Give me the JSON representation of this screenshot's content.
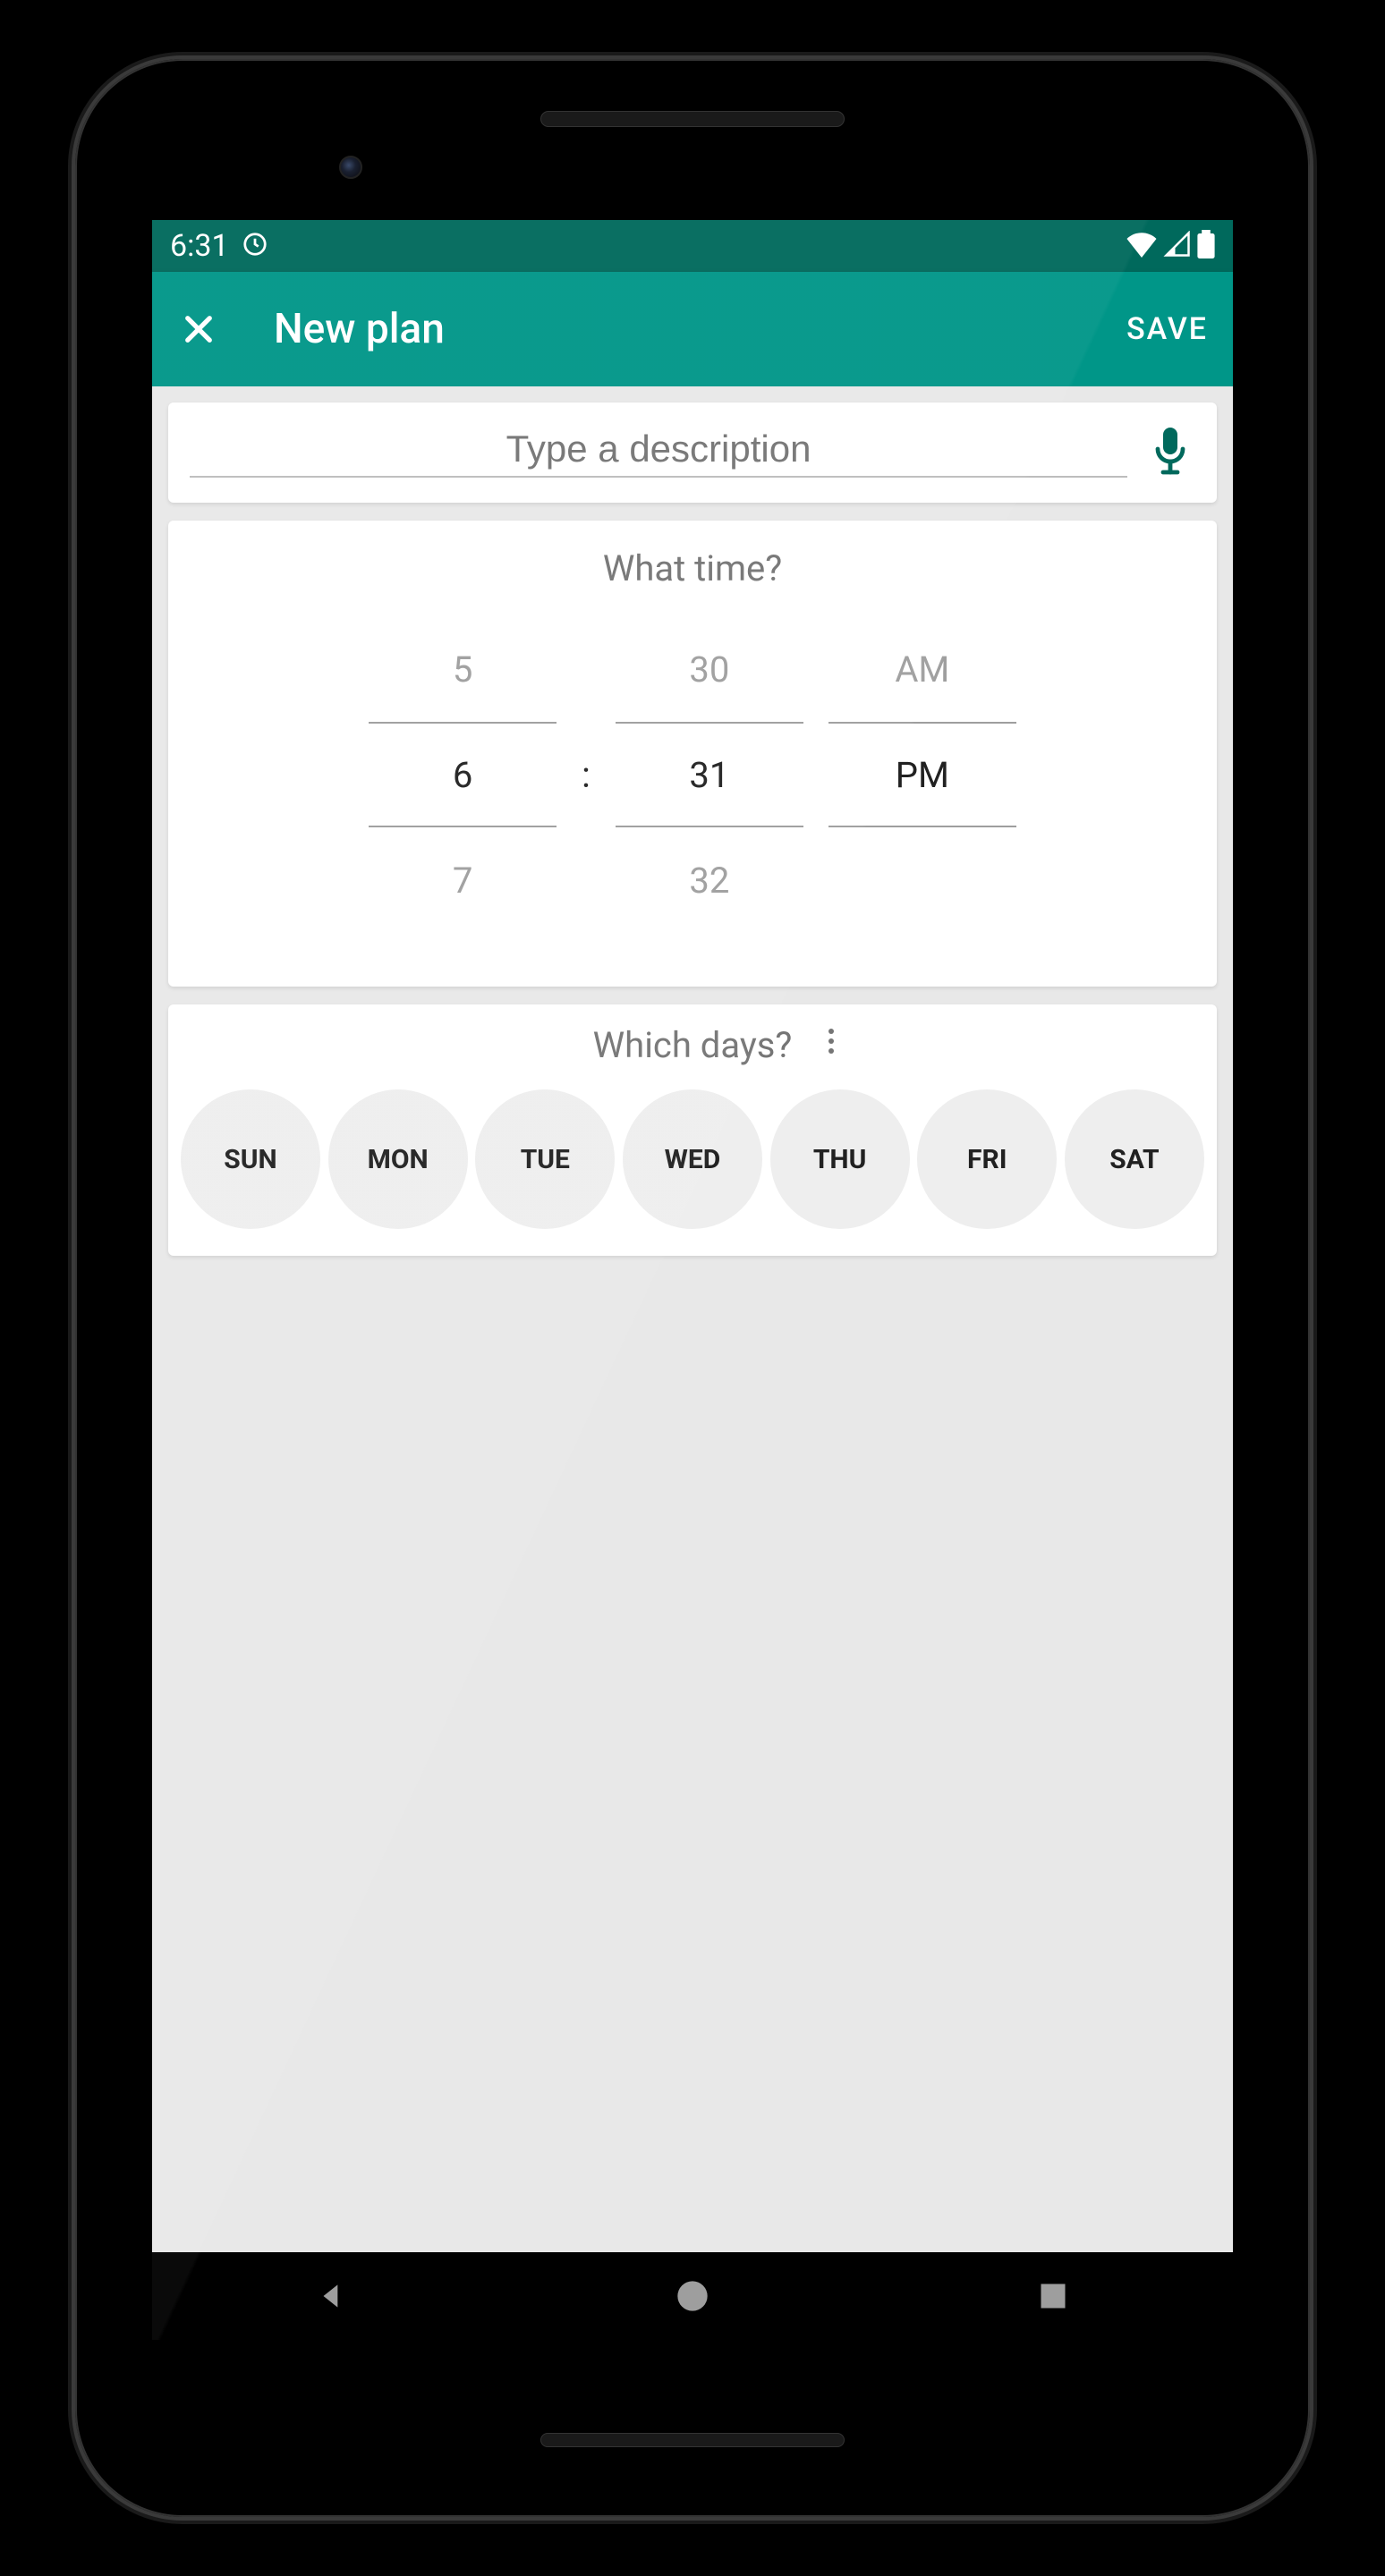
{
  "statusbar": {
    "time": "6:31"
  },
  "appbar": {
    "title": "New plan",
    "save": "SAVE"
  },
  "description": {
    "placeholder": "Type a description"
  },
  "time_section": {
    "title": "What time?",
    "hours_prev": "5",
    "hours": "6",
    "hours_next": "7",
    "minutes_prev": "30",
    "minutes": "31",
    "minutes_next": "32",
    "ampm_prev": "AM",
    "ampm": "PM",
    "separator": ":"
  },
  "days_section": {
    "title": "Which days?",
    "days": [
      "SUN",
      "MON",
      "TUE",
      "WED",
      "THU",
      "FRI",
      "SAT"
    ]
  }
}
